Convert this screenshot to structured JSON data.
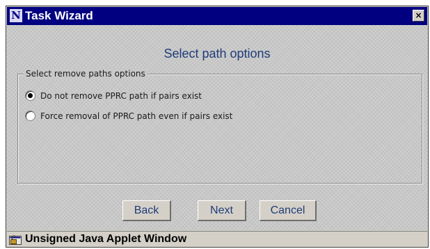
{
  "window": {
    "icon_glyph": "N",
    "title": "Task Wizard",
    "close_glyph": "×"
  },
  "heading": "Select path options",
  "group": {
    "legend": "Select remove paths options",
    "options": [
      {
        "label": "Do not remove PPRC path if pairs exist",
        "selected": true
      },
      {
        "label": "Force removal of PPRC path even if pairs exist",
        "selected": false
      }
    ]
  },
  "buttons": {
    "back": "Back",
    "next": "Next",
    "cancel": "Cancel"
  },
  "status": {
    "text": "Unsigned Java Applet Window",
    "icon": "unlocked-applet-icon"
  },
  "colors": {
    "titlebar": "#000080",
    "accent_text": "#1f3c78",
    "face": "#d4d0c8"
  }
}
